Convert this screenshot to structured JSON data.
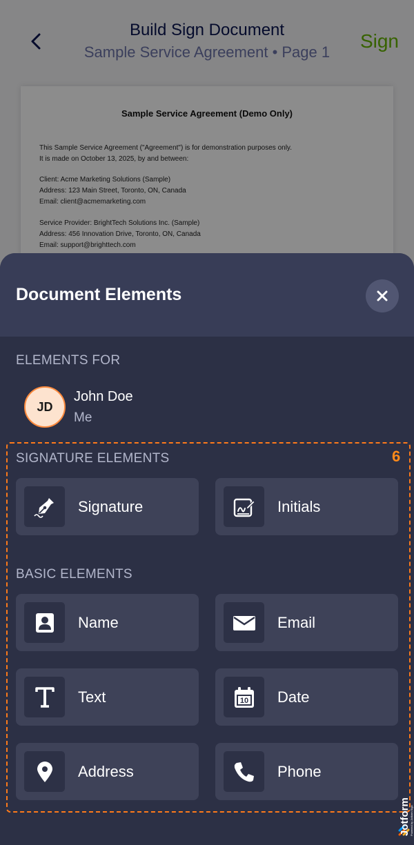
{
  "header": {
    "title": "Build Sign Document",
    "subtitle": "Sample Service Agreement • Page 1",
    "sign_label": "Sign"
  },
  "document": {
    "title": "Sample Service Agreement (Demo Only)",
    "lines": [
      "This Sample Service Agreement (\"Agreement\") is for demonstration purposes only.",
      "It is made on October 13, 2025, by and between:",
      "Client: Acme Marketing Solutions (Sample)",
      "Address: 123 Main Street, Toronto, ON, Canada",
      "Email: client@acmemarketing.com",
      "Service Provider: BrightTech Solutions Inc. (Sample)",
      "Address: 456 Innovation Drive, Toronto, ON, Canada",
      "Email: support@brighttech.com"
    ]
  },
  "sheet": {
    "title": "Document Elements",
    "elements_for_label": "ELEMENTS FOR",
    "user": {
      "initials": "JD",
      "name": "John Doe",
      "role": "Me"
    },
    "highlight_number": "6",
    "signature_section_label": "SIGNATURE ELEMENTS",
    "signature_elements": [
      {
        "label": "Signature",
        "icon": "pen-nib-icon"
      },
      {
        "label": "Initials",
        "icon": "initials-icon"
      }
    ],
    "basic_section_label": "BASIC ELEMENTS",
    "basic_elements": [
      {
        "label": "Name",
        "icon": "contact-card-icon"
      },
      {
        "label": "Email",
        "icon": "envelope-icon"
      },
      {
        "label": "Text",
        "icon": "text-t-icon"
      },
      {
        "label": "Date",
        "icon": "calendar-icon",
        "calendar_day": "10"
      },
      {
        "label": "Address",
        "icon": "map-pin-icon"
      },
      {
        "label": "Phone",
        "icon": "phone-icon"
      }
    ]
  },
  "brand": {
    "name": "Jotform",
    "tagline": "Powered by Jotform Sign"
  },
  "colors": {
    "sheet_bg": "#2c3045",
    "sheet_header_bg": "#383d57",
    "button_bg": "#3e4258",
    "highlight": "#ff7a1a",
    "sign_green": "#64b200",
    "title_navy": "#0a1551"
  }
}
